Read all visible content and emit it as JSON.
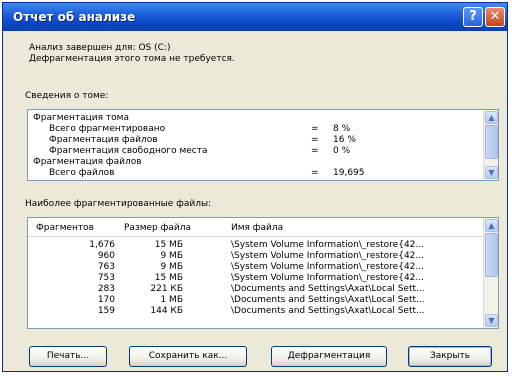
{
  "window": {
    "title": "Отчет об анализе",
    "help_label": "?",
    "close_label": "✕"
  },
  "summary": {
    "line1": "Анализ завершен для: OS (C:)",
    "line2": "Дефрагментация этого тома не требуется."
  },
  "volume_info": {
    "label": "Сведения о томе:",
    "rows": [
      {
        "label": "Фрагментация тома",
        "eq": "",
        "value": "",
        "indent": 0
      },
      {
        "label": "Всего фрагментировано",
        "eq": "=",
        "value": "8 %",
        "indent": 1
      },
      {
        "label": "Фрагментация файлов",
        "eq": "=",
        "value": "16 %",
        "indent": 1
      },
      {
        "label": "Фрагментация свободного места",
        "eq": "=",
        "value": "0 %",
        "indent": 1
      },
      {
        "label": "Фрагментация файлов",
        "eq": "",
        "value": "",
        "indent": 0
      },
      {
        "label": "Всего файлов",
        "eq": "=",
        "value": "19,695",
        "indent": 1
      }
    ]
  },
  "files": {
    "label": "Наиболее фрагментированные файлы:",
    "columns": [
      "Фрагментов",
      "Размер файла",
      "Имя файла"
    ],
    "rows": [
      {
        "frags": "1,676",
        "size": "15 МБ",
        "name": "\\System Volume Information\\_restore{42..."
      },
      {
        "frags": "960",
        "size": "9 МБ",
        "name": "\\System Volume Information\\_restore{42..."
      },
      {
        "frags": "763",
        "size": "9 МБ",
        "name": "\\System Volume Information\\_restore{42..."
      },
      {
        "frags": "753",
        "size": "15 МБ",
        "name": "\\System Volume Information\\_restore{42..."
      },
      {
        "frags": "283",
        "size": "221 КБ",
        "name": "\\Documents and Settings\\Axat\\Local Sett..."
      },
      {
        "frags": "170",
        "size": "1 МБ",
        "name": "\\Documents and Settings\\Axat\\Local Sett..."
      },
      {
        "frags": "159",
        "size": "144 КБ",
        "name": "\\Documents and Settings\\Axat\\Local Sett..."
      }
    ]
  },
  "buttons": {
    "print": "Печать...",
    "save": "Сохранить как...",
    "defrag": "Дефрагментация",
    "close": "Закрыть"
  }
}
